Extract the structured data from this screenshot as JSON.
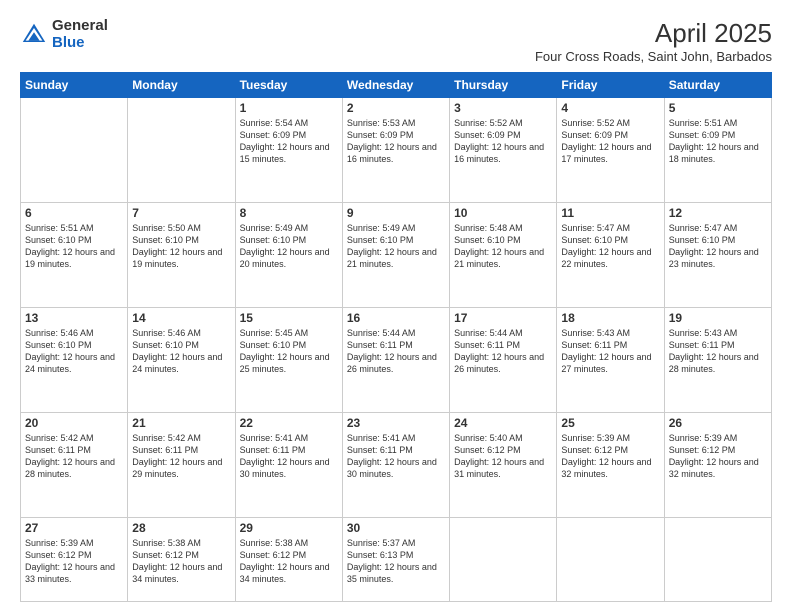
{
  "logo": {
    "general": "General",
    "blue": "Blue"
  },
  "title": "April 2025",
  "subtitle": "Four Cross Roads, Saint John, Barbados",
  "days_of_week": [
    "Sunday",
    "Monday",
    "Tuesday",
    "Wednesday",
    "Thursday",
    "Friday",
    "Saturday"
  ],
  "weeks": [
    [
      {
        "day": "",
        "info": ""
      },
      {
        "day": "",
        "info": ""
      },
      {
        "day": "1",
        "info": "Sunrise: 5:54 AM\nSunset: 6:09 PM\nDaylight: 12 hours and 15 minutes."
      },
      {
        "day": "2",
        "info": "Sunrise: 5:53 AM\nSunset: 6:09 PM\nDaylight: 12 hours and 16 minutes."
      },
      {
        "day": "3",
        "info": "Sunrise: 5:52 AM\nSunset: 6:09 PM\nDaylight: 12 hours and 16 minutes."
      },
      {
        "day": "4",
        "info": "Sunrise: 5:52 AM\nSunset: 6:09 PM\nDaylight: 12 hours and 17 minutes."
      },
      {
        "day": "5",
        "info": "Sunrise: 5:51 AM\nSunset: 6:09 PM\nDaylight: 12 hours and 18 minutes."
      }
    ],
    [
      {
        "day": "6",
        "info": "Sunrise: 5:51 AM\nSunset: 6:10 PM\nDaylight: 12 hours and 19 minutes."
      },
      {
        "day": "7",
        "info": "Sunrise: 5:50 AM\nSunset: 6:10 PM\nDaylight: 12 hours and 19 minutes."
      },
      {
        "day": "8",
        "info": "Sunrise: 5:49 AM\nSunset: 6:10 PM\nDaylight: 12 hours and 20 minutes."
      },
      {
        "day": "9",
        "info": "Sunrise: 5:49 AM\nSunset: 6:10 PM\nDaylight: 12 hours and 21 minutes."
      },
      {
        "day": "10",
        "info": "Sunrise: 5:48 AM\nSunset: 6:10 PM\nDaylight: 12 hours and 21 minutes."
      },
      {
        "day": "11",
        "info": "Sunrise: 5:47 AM\nSunset: 6:10 PM\nDaylight: 12 hours and 22 minutes."
      },
      {
        "day": "12",
        "info": "Sunrise: 5:47 AM\nSunset: 6:10 PM\nDaylight: 12 hours and 23 minutes."
      }
    ],
    [
      {
        "day": "13",
        "info": "Sunrise: 5:46 AM\nSunset: 6:10 PM\nDaylight: 12 hours and 24 minutes."
      },
      {
        "day": "14",
        "info": "Sunrise: 5:46 AM\nSunset: 6:10 PM\nDaylight: 12 hours and 24 minutes."
      },
      {
        "day": "15",
        "info": "Sunrise: 5:45 AM\nSunset: 6:10 PM\nDaylight: 12 hours and 25 minutes."
      },
      {
        "day": "16",
        "info": "Sunrise: 5:44 AM\nSunset: 6:11 PM\nDaylight: 12 hours and 26 minutes."
      },
      {
        "day": "17",
        "info": "Sunrise: 5:44 AM\nSunset: 6:11 PM\nDaylight: 12 hours and 26 minutes."
      },
      {
        "day": "18",
        "info": "Sunrise: 5:43 AM\nSunset: 6:11 PM\nDaylight: 12 hours and 27 minutes."
      },
      {
        "day": "19",
        "info": "Sunrise: 5:43 AM\nSunset: 6:11 PM\nDaylight: 12 hours and 28 minutes."
      }
    ],
    [
      {
        "day": "20",
        "info": "Sunrise: 5:42 AM\nSunset: 6:11 PM\nDaylight: 12 hours and 28 minutes."
      },
      {
        "day": "21",
        "info": "Sunrise: 5:42 AM\nSunset: 6:11 PM\nDaylight: 12 hours and 29 minutes."
      },
      {
        "day": "22",
        "info": "Sunrise: 5:41 AM\nSunset: 6:11 PM\nDaylight: 12 hours and 30 minutes."
      },
      {
        "day": "23",
        "info": "Sunrise: 5:41 AM\nSunset: 6:11 PM\nDaylight: 12 hours and 30 minutes."
      },
      {
        "day": "24",
        "info": "Sunrise: 5:40 AM\nSunset: 6:12 PM\nDaylight: 12 hours and 31 minutes."
      },
      {
        "day": "25",
        "info": "Sunrise: 5:39 AM\nSunset: 6:12 PM\nDaylight: 12 hours and 32 minutes."
      },
      {
        "day": "26",
        "info": "Sunrise: 5:39 AM\nSunset: 6:12 PM\nDaylight: 12 hours and 32 minutes."
      }
    ],
    [
      {
        "day": "27",
        "info": "Sunrise: 5:39 AM\nSunset: 6:12 PM\nDaylight: 12 hours and 33 minutes."
      },
      {
        "day": "28",
        "info": "Sunrise: 5:38 AM\nSunset: 6:12 PM\nDaylight: 12 hours and 34 minutes."
      },
      {
        "day": "29",
        "info": "Sunrise: 5:38 AM\nSunset: 6:12 PM\nDaylight: 12 hours and 34 minutes."
      },
      {
        "day": "30",
        "info": "Sunrise: 5:37 AM\nSunset: 6:13 PM\nDaylight: 12 hours and 35 minutes."
      },
      {
        "day": "",
        "info": ""
      },
      {
        "day": "",
        "info": ""
      },
      {
        "day": "",
        "info": ""
      }
    ]
  ]
}
